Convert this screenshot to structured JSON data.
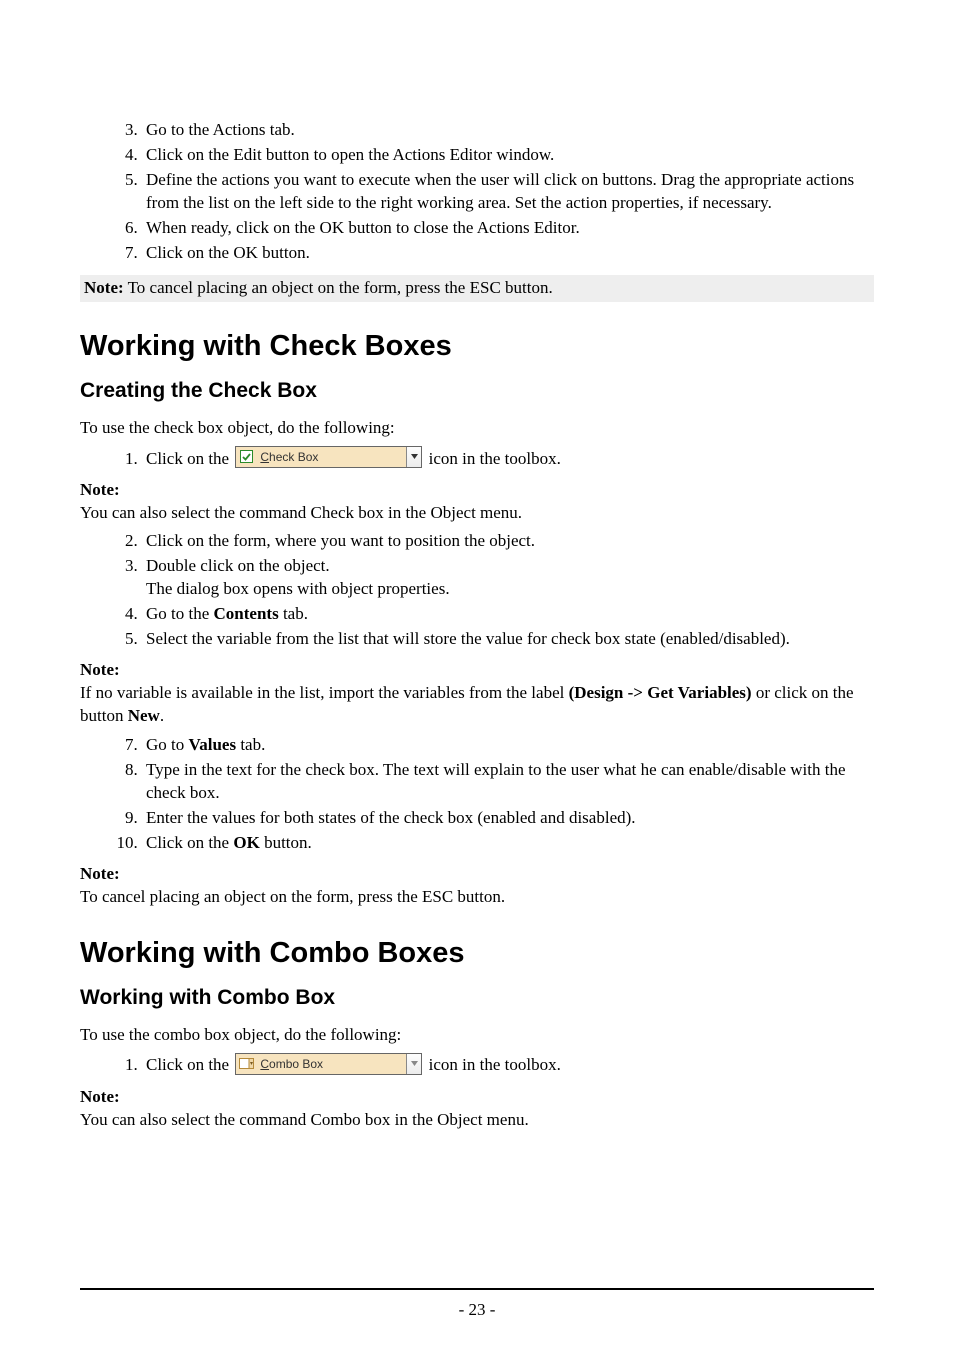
{
  "listA": {
    "l3": "Go to the Actions tab.",
    "l4": "Click on the Edit button to open the Actions Editor window.",
    "l5": "Define the actions you want to execute when the user will click on buttons. Drag the appropriate actions from the list on the left side to the right working area. Set the action properties, if necessary.",
    "l6": "When ready, click on the OK button to close the Actions Editor.",
    "l7": "Click on the OK button."
  },
  "noteA": {
    "label": "Note:",
    "text": "To cancel placing an object on the form, press the ESC button."
  },
  "h1a": "Working with Check Boxes",
  "h2a": "Creating the Check Box",
  "introA": "To use the check  box object, do the following:",
  "listB": {
    "l1_pre": "Click on the ",
    "l1_icon_label": "Check Box",
    "l1_post": " icon in the toolbox."
  },
  "noteB": {
    "label": "Note:",
    "text": "You can also select the command Check box in the Object menu."
  },
  "listC": {
    "l2": "Click on the form, where you want to position the object.",
    "l3": "Double click on the object.",
    "l3b": "The dialog box opens with object properties.",
    "l4_pre": "Go to the ",
    "l4_bold": "Contents",
    "l4_post": " tab.",
    "l5": "Select the variable from the list that will store the value for check box state (enabled/disabled)."
  },
  "noteC": {
    "label": "Note:",
    "text_a": "If no variable is available in the list, import the variables from the label ",
    "text_bold1": "(Design -> Get Variables)",
    "text_b": " or click on the button ",
    "text_bold2": "New",
    "text_c": "."
  },
  "listD": {
    "l7_pre": "Go to ",
    "l7_bold": "Values",
    "l7_post": " tab.",
    "l8": "Type in the text for the check box. The text will explain to the user what he can enable/disable with the check box.",
    "l9": "Enter the values for both states of the check box (enabled and disabled).",
    "l10_pre": "Click on the ",
    "l10_bold": "OK",
    "l10_post": " button."
  },
  "noteD": {
    "label": "Note:",
    "text": "To cancel placing an object on the form, press the ESC button."
  },
  "h1b": "Working with Combo Boxes",
  "h2b": "Working with Combo Box",
  "introB": "To use the combo box object, do the following:",
  "listE": {
    "l1_pre": "Click on the ",
    "l1_icon_label": "Combo Box",
    "l1_post": " icon in the toolbox."
  },
  "noteE": {
    "label": "Note:",
    "text": "You can also select the command Combo box  in the Object menu."
  },
  "pagenum": "- 23 -"
}
